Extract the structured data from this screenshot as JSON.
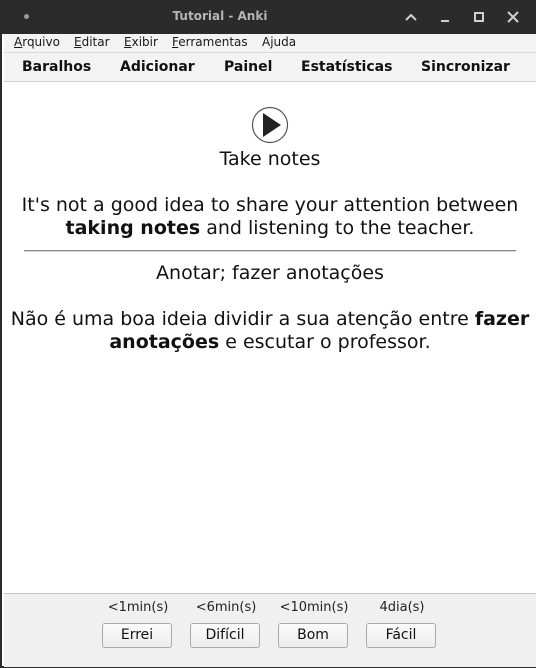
{
  "window": {
    "title": "Tutorial - Anki"
  },
  "menubar": {
    "items": [
      {
        "accel": "A",
        "rest": "rquivo"
      },
      {
        "accel": "E",
        "rest": "ditar"
      },
      {
        "accel": "E",
        "rest": "xibir"
      },
      {
        "accel": "F",
        "rest": "erramentas"
      },
      {
        "accel": "",
        "rest": "Ajuda"
      }
    ]
  },
  "toolbar": {
    "items": [
      "Baralhos",
      "Adicionar",
      "Painel",
      "Estatísticas",
      "Sincronizar"
    ]
  },
  "card": {
    "front_word": "Take notes",
    "front_sentence": {
      "before": "It's not a good idea to share your attention between ",
      "bold": "taking notes",
      "after": " and listening to the teacher."
    },
    "back_word": "Anotar; fazer anotações",
    "back_sentence": {
      "before": "Não é uma boa ideia dividir a sua atenção entre ",
      "bold": "fazer anotações",
      "after": " e escutar o professor."
    }
  },
  "answers": [
    {
      "interval": "<1min(s)",
      "label": "Errei"
    },
    {
      "interval": "<6min(s)",
      "label": "Difícil"
    },
    {
      "interval": "<10min(s)",
      "label": "Bom"
    },
    {
      "interval": "4dia(s)",
      "label": "Fácil"
    }
  ],
  "icons": {
    "play": "play-icon",
    "minimize": "chevron-up-icon",
    "restore": "minimize-icon",
    "maximize": "maximize-icon",
    "close": "close-icon"
  }
}
